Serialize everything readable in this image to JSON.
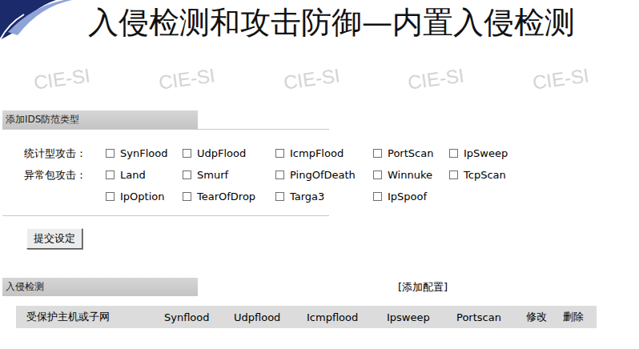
{
  "title": "入侵检测和攻击防御—内置入侵检测",
  "watermarks": [
    "CIE-SI",
    "CIE-SI",
    "CIE-SI",
    "CIE-SI",
    "CIE-SI"
  ],
  "add_section": {
    "header": "添加IDS防范类型",
    "groups": [
      {
        "label": "统计型攻击：",
        "options": [
          {
            "label": "SynFlood",
            "checked": false
          },
          {
            "label": "UdpFlood",
            "checked": false
          },
          {
            "label": "IcmpFlood",
            "checked": false
          },
          {
            "label": "PortScan",
            "checked": false
          },
          {
            "label": "IpSweep",
            "checked": false
          }
        ]
      },
      {
        "label": "异常包攻击：",
        "options": [
          {
            "label": "Land",
            "checked": false
          },
          {
            "label": "Smurf",
            "checked": false
          },
          {
            "label": "PingOfDeath",
            "checked": false
          },
          {
            "label": "Winnuke",
            "checked": false
          },
          {
            "label": "TcpScan",
            "checked": false
          },
          {
            "label": "IpOption",
            "checked": false
          },
          {
            "label": "TearOfDrop",
            "checked": false
          },
          {
            "label": "Targa3",
            "checked": false
          },
          {
            "label": "IpSpoof",
            "checked": false
          }
        ]
      }
    ],
    "submit_button": "提交设定"
  },
  "detect_section": {
    "header": "入侵检测",
    "add_link": "[添加配置]",
    "table": {
      "columns": [
        "受保护主机或子网",
        "Synflood",
        "Udpflood",
        "Icmpflood",
        "Ipsweep",
        "Portscan",
        "修改",
        "删除"
      ],
      "rows": []
    }
  }
}
